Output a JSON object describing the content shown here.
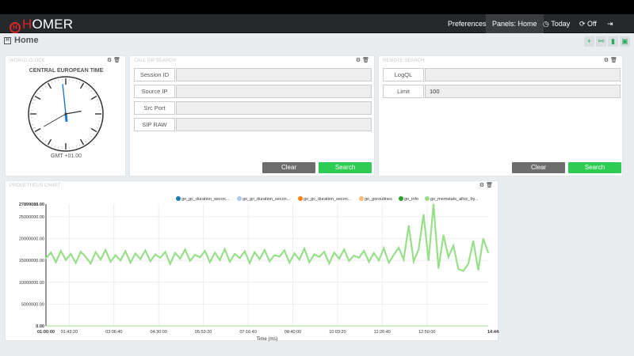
{
  "app": {
    "logo": "HOMER",
    "logo_mark": "H"
  },
  "nav": {
    "items": [
      {
        "label": "Preferences"
      },
      {
        "label": "Panels: Home"
      },
      {
        "label": "Today",
        "icon": "clock-icon"
      },
      {
        "label": "Off",
        "icon": "refresh-icon"
      },
      {
        "icon": "logout-icon"
      }
    ]
  },
  "page": {
    "title": "Home",
    "toolbar": [
      {
        "icon": "plus-icon",
        "glyph": "+"
      },
      {
        "icon": "share-icon",
        "glyph": "⚯"
      },
      {
        "icon": "trash-icon",
        "glyph": "▮"
      },
      {
        "icon": "save-icon",
        "glyph": "▣"
      }
    ]
  },
  "clock": {
    "title": "WORLD CLOCK",
    "zone": "CENTRAL EUROPEAN TIME",
    "offset": "GMT +01.00",
    "hour_angle": 80,
    "minute_angle": -6,
    "second_angle": 240
  },
  "sip_search": {
    "title": "CALL SIP SEARCH",
    "fields": [
      {
        "label": "Session ID",
        "value": ""
      },
      {
        "label": "Source IP",
        "value": ""
      },
      {
        "label": "Src Port",
        "value": ""
      },
      {
        "label": "SIP RAW",
        "value": ""
      }
    ],
    "clear": "Clear",
    "search": "Search"
  },
  "remote_search": {
    "title": "REMOTE SEARCH",
    "fields": [
      {
        "label": "LogQL",
        "value": ""
      },
      {
        "label": "Limit",
        "value": "100"
      }
    ],
    "clear": "Clear",
    "search": "Search"
  },
  "prometheus": {
    "title": "PROMETHEUS CHART"
  },
  "chart_data": {
    "type": "line",
    "xlabel": "Time (ms)",
    "ylabel": "",
    "ylim": [
      0,
      27899088
    ],
    "yticks": [
      "27899088.00",
      "25000000.00",
      "20000000.00",
      "15000000.00",
      "10000000.00",
      "5000000.00",
      "0.00"
    ],
    "ytick_values": [
      27899088,
      25000000,
      20000000,
      15000000,
      10000000,
      5000000,
      0
    ],
    "xticks": [
      "01:00:00",
      "01:43:20",
      "03:06:40",
      "04:30:00",
      "05:53:20",
      "07:16:40",
      "08:40:00",
      "10:03:20",
      "11:26:40",
      "12:50:00",
      "14:44:00"
    ],
    "xtick_minutes": [
      0,
      43.33,
      126.67,
      210,
      293.33,
      376.67,
      460,
      543.33,
      626.67,
      710,
      824
    ],
    "legend_position": "top-right",
    "series": [
      {
        "name": "go_gc_duration_secon...",
        "color": "#1f77b4",
        "values": []
      },
      {
        "name": "go_gc_duration_secon...",
        "color": "#aec7e8",
        "values": []
      },
      {
        "name": "go_gc_duration_secon...",
        "color": "#ff7f0e",
        "values": []
      },
      {
        "name": "go_goroutines",
        "color": "#ffbb78",
        "values": []
      },
      {
        "name": "go_info",
        "color": "#2ca02c",
        "values": []
      },
      {
        "name": "go_memstats_alloc_by...",
        "color": "#98df8a",
        "values": [
          15500000,
          16800000,
          14600000,
          17200000,
          15100000,
          16500000,
          14400000,
          17000000,
          15800000,
          14300000,
          16900000,
          15200000,
          17400000,
          14700000,
          16200000,
          15000000,
          17100000,
          14500000,
          16600000,
          15300000,
          17300000,
          14800000,
          16400000,
          15600000,
          17000000,
          14200000,
          16700000,
          15400000,
          17500000,
          14900000,
          16300000,
          15700000,
          17200000,
          14600000,
          16800000,
          15100000,
          17600000,
          14700000,
          16500000,
          15500000,
          17100000,
          14400000,
          16900000,
          15300000,
          17400000,
          14800000,
          16200000,
          15900000,
          17300000,
          14500000,
          16600000,
          15200000,
          17700000,
          14600000,
          16400000,
          15800000,
          17000000,
          14300000,
          16800000,
          15400000,
          17500000,
          14900000,
          16100000,
          15600000,
          17200000,
          14700000,
          16700000,
          15000000,
          17800000,
          14500000,
          16300000,
          17900000,
          15200000,
          23000000,
          14800000,
          17500000,
          25500000,
          15000000,
          27899088,
          13200000,
          20800000,
          15800000,
          18400000,
          13000000,
          12600000,
          14200000,
          19500000,
          12800000,
          20000000,
          16800000
        ]
      }
    ]
  }
}
